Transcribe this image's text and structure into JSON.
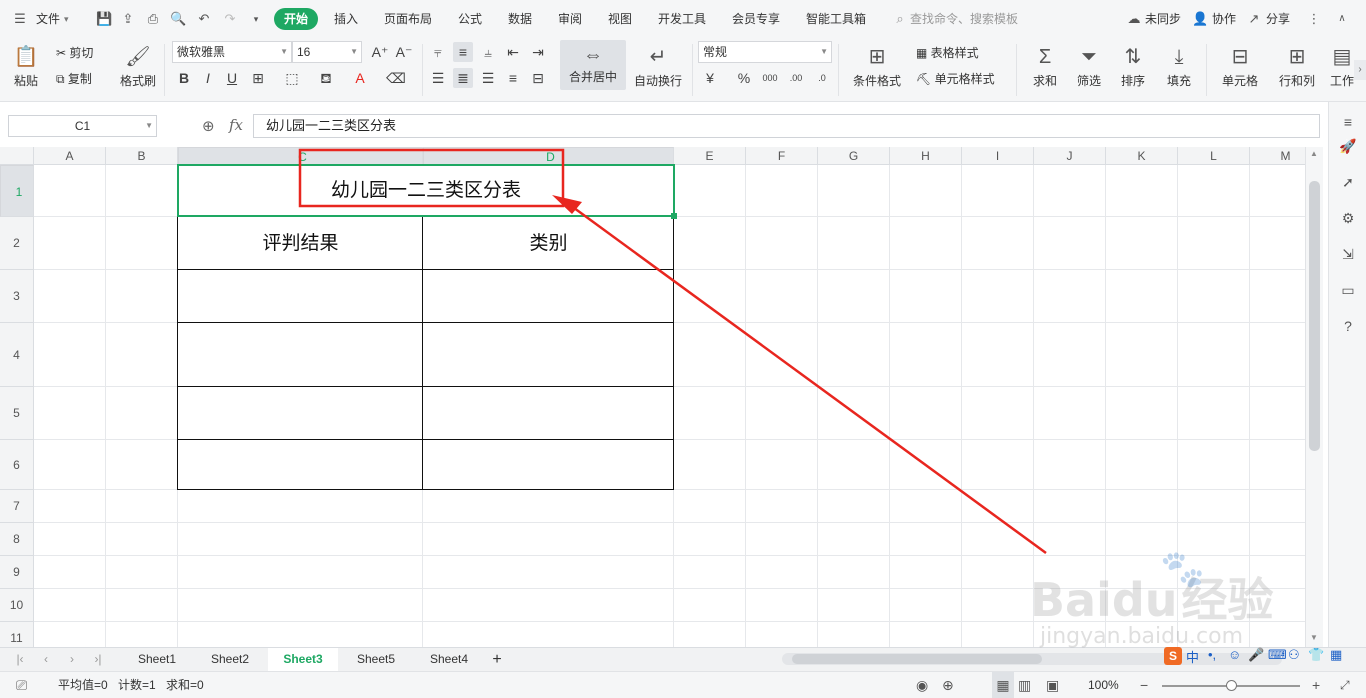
{
  "menubar": {
    "hamburger_icon": "menu-icon",
    "file_label": "文件",
    "tabs": [
      "开始",
      "插入",
      "页面布局",
      "公式",
      "数据",
      "审阅",
      "视图",
      "开发工具",
      "会员专享",
      "智能工具箱"
    ],
    "search_placeholder": "查找命令、搜索模板",
    "sync_label": "未同步",
    "collab_label": "协作",
    "share_label": "分享"
  },
  "ribbon": {
    "paste": "粘贴",
    "cut": "剪切",
    "copy": "复制",
    "format_painter": "格式刷",
    "font_name": "微软雅黑",
    "font_size": "16",
    "merge_center": "合并居中",
    "wrap_text": "自动换行",
    "number_format": "常规",
    "conditional_format": "条件格式",
    "table_style": "表格样式",
    "cell_style": "单元格样式",
    "sum": "求和",
    "filter": "筛选",
    "sort": "排序",
    "fill": "填充",
    "cells": "单元格",
    "rows_cols": "行和列",
    "worksheet": "工作"
  },
  "formula_bar": {
    "name_box": "C1",
    "fx": "fx",
    "content": "幼儿园一二三类区分表"
  },
  "grid": {
    "columns": [
      "A",
      "B",
      "C",
      "D",
      "E",
      "F",
      "G",
      "H",
      "I",
      "J",
      "K",
      "L",
      "M"
    ],
    "rows": [
      "1",
      "2",
      "3",
      "4",
      "5",
      "6",
      "7",
      "8",
      "9",
      "10",
      "11"
    ],
    "title": "幼儿园一二三类区分表",
    "header_left": "评判结果",
    "header_right": "类别"
  },
  "sheets": {
    "tabs": [
      "Sheet1",
      "Sheet2",
      "Sheet3",
      "Sheet5",
      "Sheet4"
    ],
    "active": "Sheet3",
    "add": "+"
  },
  "status": {
    "average": "平均值=0",
    "count": "计数=1",
    "sum": "求和=0",
    "zoom": "100%"
  },
  "colors": {
    "accent": "#1ea863",
    "annotation": "#e8261f"
  },
  "watermark": {
    "brand": "Baidu",
    "suffix": "经验",
    "url": "jingyan.baidu.com"
  }
}
